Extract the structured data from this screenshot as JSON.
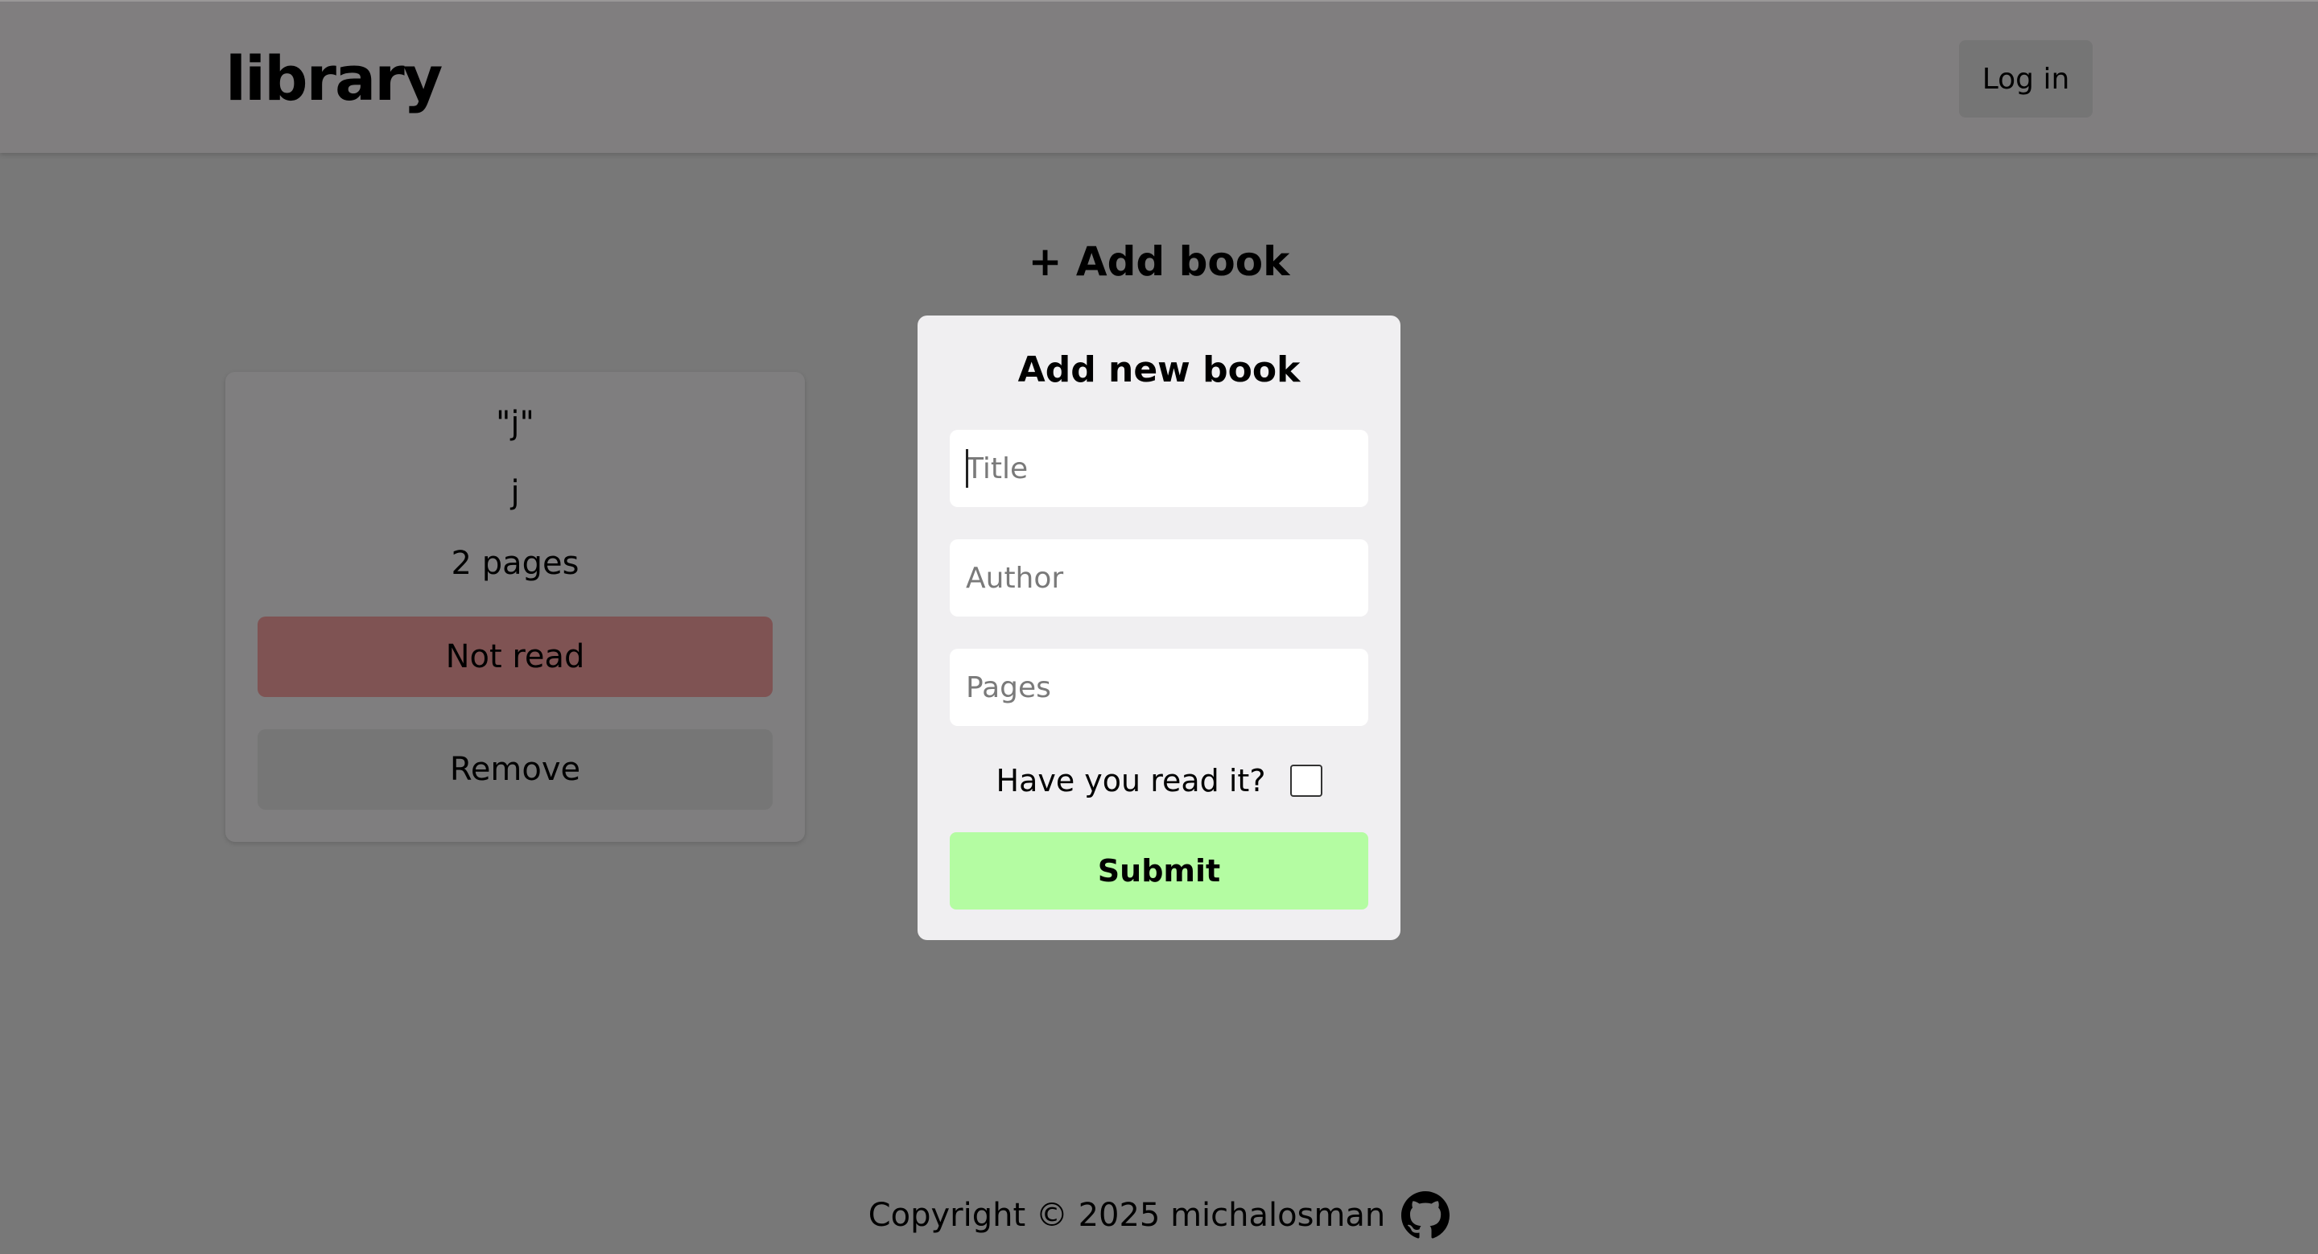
{
  "header": {
    "logo": "library",
    "login_label": "Log in"
  },
  "main": {
    "add_book_label": "+ Add book"
  },
  "book": {
    "title": "\"j\"",
    "author": "j",
    "pages": "2 pages",
    "read_status_label": "Not read",
    "remove_label": "Remove"
  },
  "modal": {
    "title": "Add new book",
    "fields": {
      "title_placeholder": "Title",
      "author_placeholder": "Author",
      "pages_placeholder": "Pages"
    },
    "read_question": "Have you read it?",
    "read_checked": false,
    "submit_label": "Submit"
  },
  "footer": {
    "copyright": "Copyright © 2025 michalosman",
    "icon": "github-icon"
  },
  "colors": {
    "overlay_bg": "#787878",
    "not_read": "#7f5353",
    "submit": "#b4fca2",
    "modal_bg": "#f0eff1"
  }
}
